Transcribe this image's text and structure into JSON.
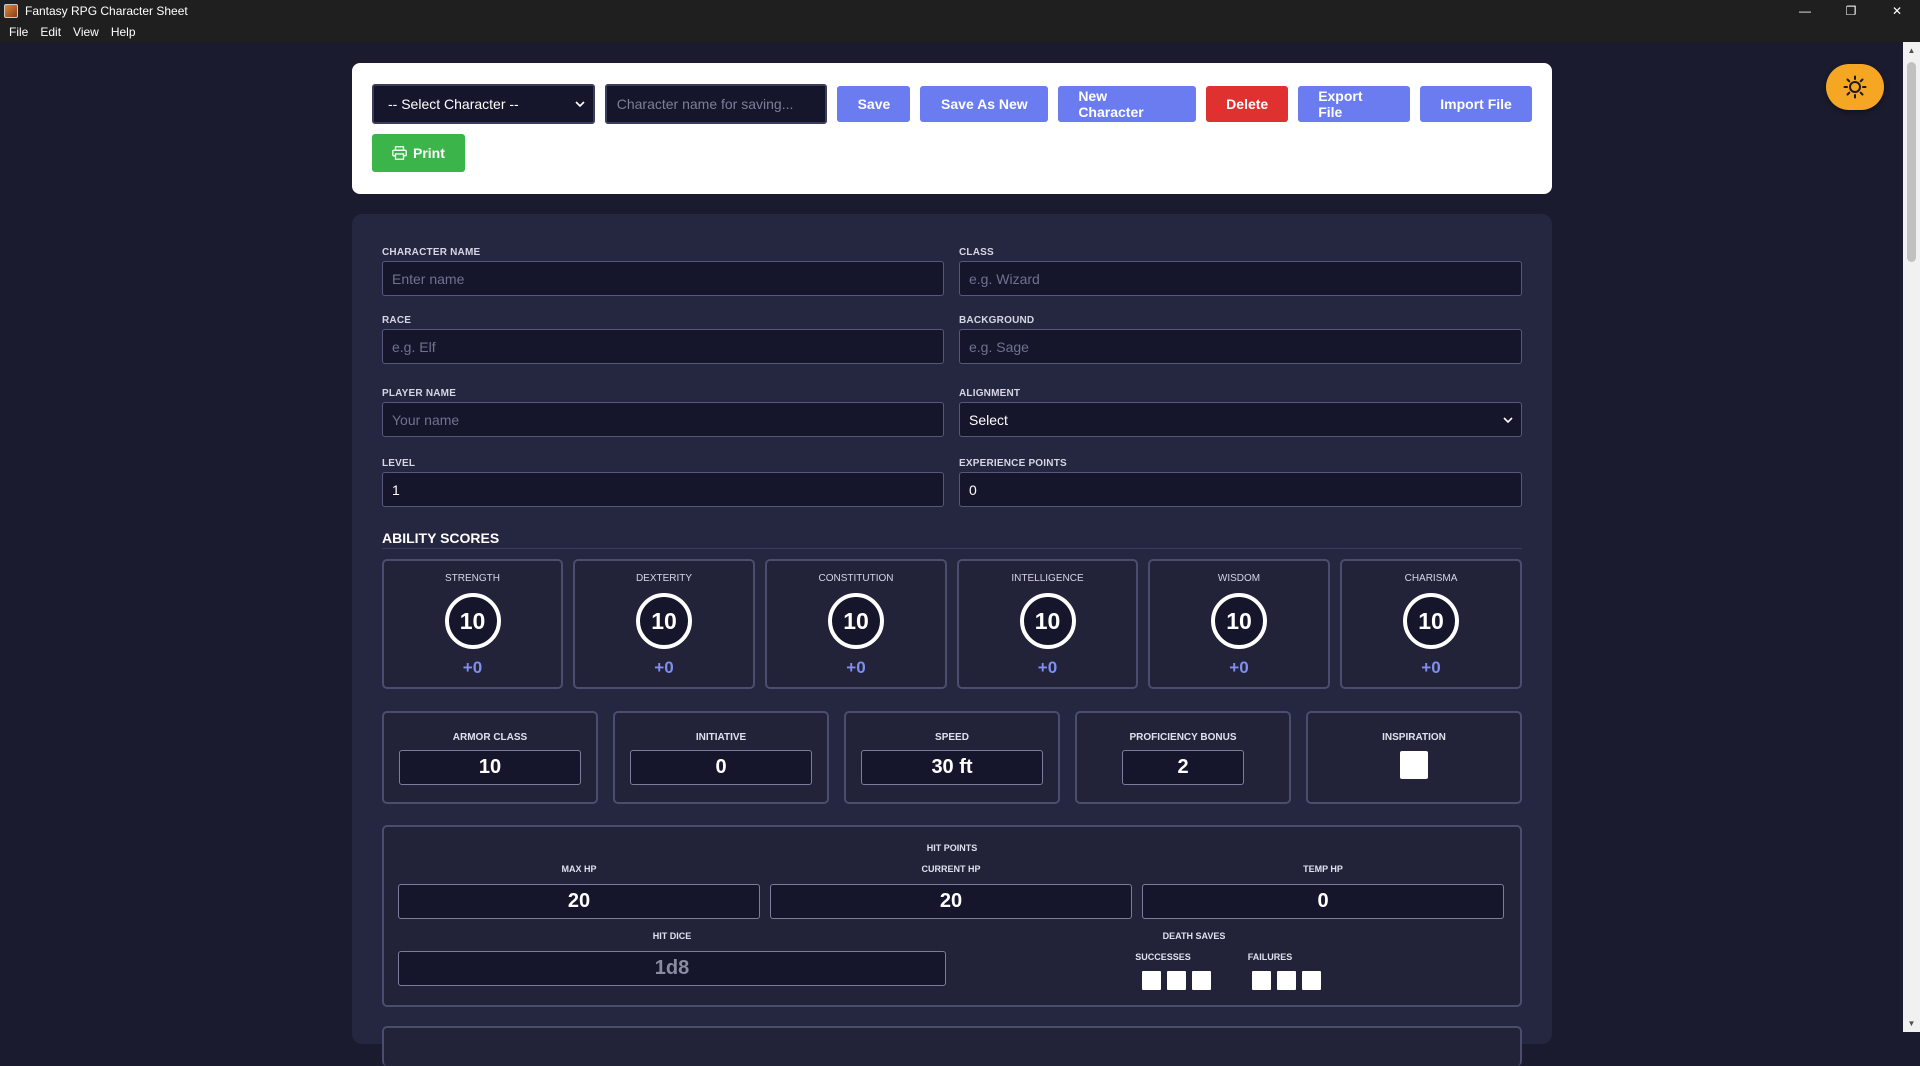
{
  "window": {
    "title": "Fantasy RPG Character Sheet",
    "minimize": "—",
    "maximize": "❐",
    "close": "✕"
  },
  "menu": [
    "File",
    "Edit",
    "View",
    "Help"
  ],
  "toolbar": {
    "select_character": "-- Select Character --",
    "name_placeholder": "Character name for saving...",
    "save": "Save",
    "save_as_new": "Save As New",
    "new_character": "New Character",
    "delete": "Delete",
    "export_file": "Export File",
    "import_file": "Import File",
    "print": "Print"
  },
  "fields": {
    "character_name": {
      "label": "CHARACTER NAME",
      "placeholder": "Enter name"
    },
    "class": {
      "label": "CLASS",
      "placeholder": "e.g. Wizard"
    },
    "race": {
      "label": "RACE",
      "placeholder": "e.g. Elf"
    },
    "background": {
      "label": "BACKGROUND",
      "placeholder": "e.g. Sage"
    },
    "player_name": {
      "label": "PLAYER NAME",
      "placeholder": "Your name"
    },
    "alignment": {
      "label": "ALIGNMENT",
      "value": "Select"
    },
    "level": {
      "label": "LEVEL",
      "value": "1"
    },
    "experience": {
      "label": "EXPERIENCE POINTS",
      "value": "0"
    }
  },
  "abilities": {
    "title": "ABILITY SCORES",
    "items": [
      {
        "label": "STRENGTH",
        "score": "10",
        "mod": "+0"
      },
      {
        "label": "DEXTERITY",
        "score": "10",
        "mod": "+0"
      },
      {
        "label": "CONSTITUTION",
        "score": "10",
        "mod": "+0"
      },
      {
        "label": "INTELLIGENCE",
        "score": "10",
        "mod": "+0"
      },
      {
        "label": "WISDOM",
        "score": "10",
        "mod": "+0"
      },
      {
        "label": "CHARISMA",
        "score": "10",
        "mod": "+0"
      }
    ]
  },
  "combat": {
    "armor_class": {
      "label": "ARMOR CLASS",
      "value": "10"
    },
    "initiative": {
      "label": "INITIATIVE",
      "value": "0"
    },
    "speed": {
      "label": "SPEED",
      "value": "30 ft"
    },
    "proficiency": {
      "label": "PROFICIENCY BONUS",
      "value": "2"
    },
    "inspiration": {
      "label": "INSPIRATION"
    }
  },
  "hit_points": {
    "title": "HIT POINTS",
    "max_hp": {
      "label": "MAX HP",
      "value": "20"
    },
    "current_hp": {
      "label": "CURRENT HP",
      "value": "20"
    },
    "temp_hp": {
      "label": "TEMP HP",
      "value": "0"
    },
    "hit_dice": {
      "label": "HIT DICE",
      "value": "1d8"
    },
    "death_saves": {
      "title": "DEATH SAVES",
      "successes": "SUCCESSES",
      "failures": "FAILURES"
    }
  },
  "icons": {
    "theme": "sun-icon",
    "print": "printer-icon",
    "dropdown": "chevron-down-icon"
  }
}
